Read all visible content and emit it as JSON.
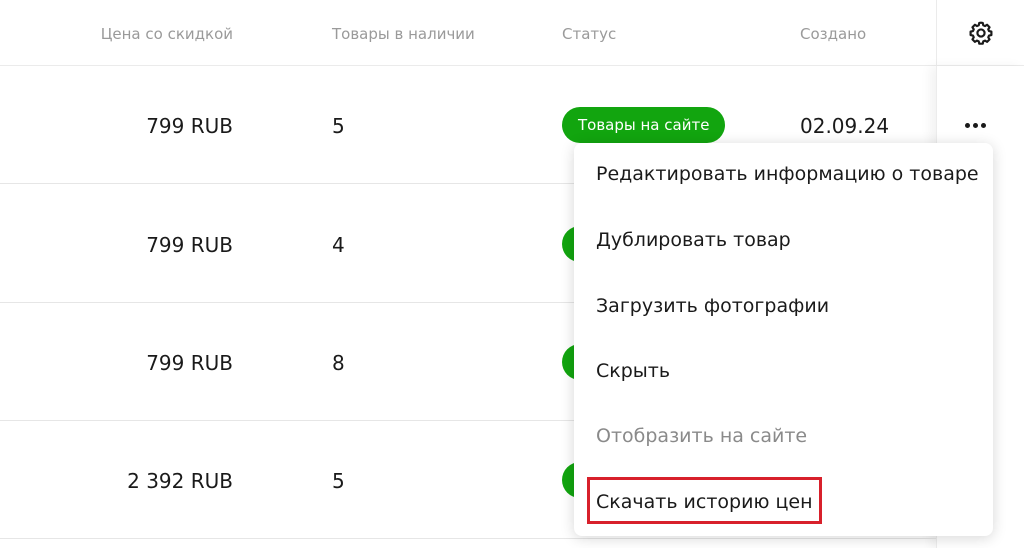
{
  "columns": {
    "price": "Цена со скидкой",
    "stock": "Товары в наличии",
    "status": "Статус",
    "created": "Создано"
  },
  "rows": [
    {
      "price": "799 RUB",
      "stock": "5",
      "status": "Товары на сайте",
      "created": "02.09.24"
    },
    {
      "price": "799 RUB",
      "stock": "4"
    },
    {
      "price": "799 RUB",
      "stock": "8"
    },
    {
      "price": "2 392 RUB",
      "stock": "5"
    }
  ],
  "icons": {
    "settings": "gear-icon",
    "more": "more-horizontal-icon"
  },
  "menu": {
    "items": [
      {
        "label": "Редактировать информацию о товаре",
        "enabled": true
      },
      {
        "label": "Дублировать товар",
        "enabled": true
      },
      {
        "label": "Загрузить фотографии",
        "enabled": true
      },
      {
        "label": "Скрыть",
        "enabled": true
      },
      {
        "label": "Отобразить на сайте",
        "enabled": false
      },
      {
        "label": "Скачать историю цен",
        "enabled": true,
        "highlighted": true
      }
    ]
  },
  "colors": {
    "status_green": "#12a50f",
    "highlight_red": "#d8202b",
    "header_text": "#9a9a9a"
  }
}
